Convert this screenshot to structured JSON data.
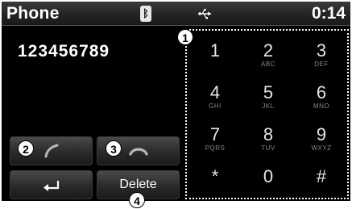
{
  "status_bar": {
    "title": "Phone",
    "bluetooth_icon": "bluetooth-icon",
    "usb_icon": "usb-icon",
    "time": "0:14"
  },
  "dial_display": {
    "number": "123456789"
  },
  "buttons": {
    "call_icon": "handset-call-icon",
    "end_icon": "handset-end-icon",
    "back_icon": "back-arrow-icon",
    "delete_label": "Delete"
  },
  "keypad": {
    "keys": [
      {
        "digit": "1",
        "letters": ""
      },
      {
        "digit": "2",
        "letters": "ABC"
      },
      {
        "digit": "3",
        "letters": "DEF"
      },
      {
        "digit": "4",
        "letters": "GHI"
      },
      {
        "digit": "5",
        "letters": "JKL"
      },
      {
        "digit": "6",
        "letters": "MNO"
      },
      {
        "digit": "7",
        "letters": "PQRS"
      },
      {
        "digit": "8",
        "letters": "TUV"
      },
      {
        "digit": "9",
        "letters": "WXYZ"
      },
      {
        "digit": "*",
        "letters": ""
      },
      {
        "digit": "0",
        "letters": ""
      },
      {
        "digit": "#",
        "letters": ""
      }
    ]
  },
  "callouts": [
    "1",
    "2",
    "3",
    "4"
  ],
  "colors": {
    "background": "#000000",
    "text": "#ffffff",
    "key_letters": "#888888"
  }
}
